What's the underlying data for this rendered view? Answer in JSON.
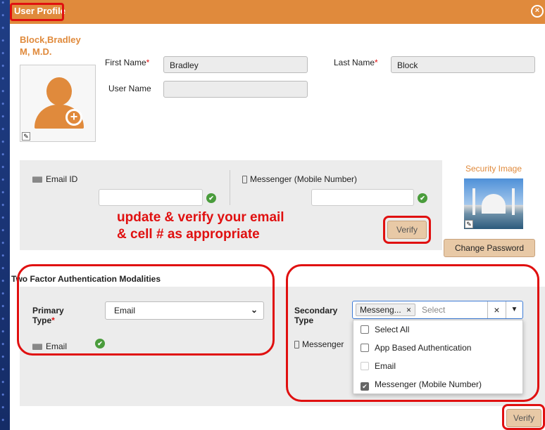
{
  "dialog": {
    "title": "User Profile",
    "close_glyph": "×",
    "accent": "#e08a3c"
  },
  "profile": {
    "display_name_line1": "Block,Bradley",
    "display_name_line2": "M, M.D.",
    "first_name_label": "First Name",
    "first_name": "Bradley",
    "last_name_label": "Last Name",
    "last_name": "Block",
    "user_name_label": "User Name",
    "user_name": "",
    "required_mark": "*"
  },
  "contact": {
    "email_label": "Email ID",
    "email_value": "",
    "messenger_label": "Messenger (Mobile Number)",
    "messenger_value": "",
    "verify_label": "Verify"
  },
  "annotation": {
    "line1": "update & verify your email",
    "line2": "& cell # as appropriate",
    "color": "#e01010"
  },
  "security": {
    "title": "Security Image",
    "change_password_label": "Change Password"
  },
  "two_factor": {
    "title": "Two Factor Authentication Modalities",
    "primary_label_line1": "Primary",
    "primary_label_line2": "Type",
    "primary_value": "Email",
    "primary_method": "Email",
    "secondary_label_line1": "Secondary",
    "secondary_label_line2": "Type",
    "secondary_chip": "Messeng...",
    "secondary_chip_remove": "×",
    "secondary_placeholder": "Select",
    "secondary_clear": "×",
    "secondary_method": "Messenger",
    "options": [
      {
        "label": "Select All",
        "checked": false,
        "disabled": false
      },
      {
        "label": "App Based Authentication",
        "checked": false,
        "disabled": false
      },
      {
        "label": "Email",
        "checked": false,
        "disabled": true
      },
      {
        "label": "Messenger (Mobile Number)",
        "checked": true,
        "disabled": false
      }
    ],
    "verify_label": "Verify"
  }
}
